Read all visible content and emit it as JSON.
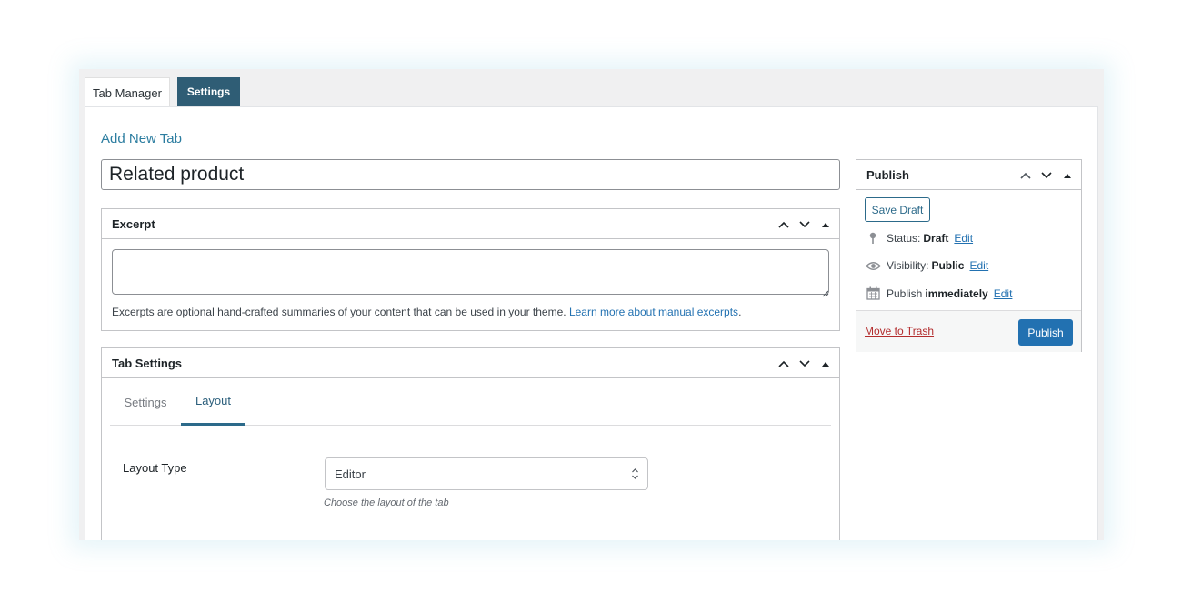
{
  "tabs": {
    "tab_manager": "Tab Manager",
    "settings": "Settings"
  },
  "page": {
    "heading": "Add New Tab",
    "title_value": "Related product"
  },
  "excerpt": {
    "title": "Excerpt",
    "value": "",
    "note": "Excerpts are optional hand-crafted summaries of your content that can be used in your theme.",
    "learn_more": "Learn more about manual excerpts",
    "note_end": "."
  },
  "tab_settings": {
    "title": "Tab Settings",
    "subtabs": [
      "Settings",
      "Layout"
    ],
    "active_subtab": "Layout",
    "layout_type_label": "Layout Type",
    "layout_type_value": "Editor",
    "layout_help": "Choose the layout of the tab"
  },
  "publish": {
    "title": "Publish",
    "save_draft": "Save Draft",
    "status_label": "Status:",
    "status_value": "Draft",
    "visibility_label": "Visibility:",
    "visibility_value": "Public",
    "publish_label": "Publish",
    "publish_value": "immediately",
    "edit": "Edit",
    "move_to_trash": "Move to Trash",
    "publish_button": "Publish"
  },
  "colors": {
    "accent": "#2271b1",
    "tab_active": "#2f5d75",
    "trash": "#b32d2e"
  }
}
